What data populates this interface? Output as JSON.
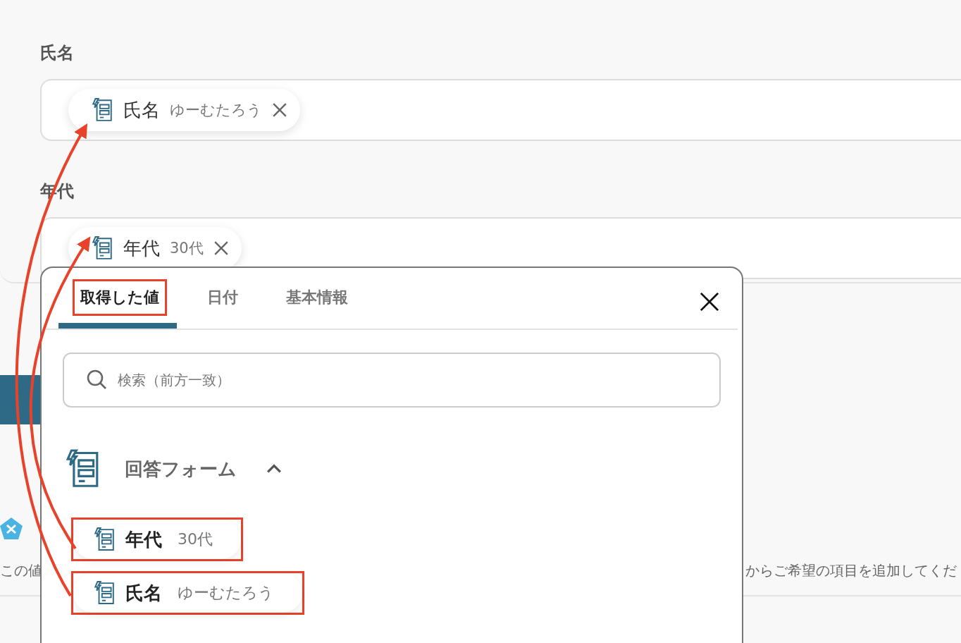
{
  "fields": [
    {
      "label": "氏名",
      "chip": {
        "name": "氏名",
        "value": "ゆーむたろう"
      }
    },
    {
      "label": "年代",
      "chip": {
        "name": "年代",
        "value": "30代"
      }
    }
  ],
  "behind": {
    "description_left": "この値",
    "description_right": "からご希望の項目を追加してくだ"
  },
  "popup": {
    "tabs": [
      {
        "label": "取得した値",
        "selected": true,
        "highlighted": true
      },
      {
        "label": "日付",
        "selected": false,
        "highlighted": false
      },
      {
        "label": "基本情報",
        "selected": false,
        "highlighted": false
      }
    ],
    "search": {
      "placeholder": "検索（前方一致）"
    },
    "group": {
      "title": "回答フォーム",
      "expanded": true,
      "items": [
        {
          "name": "年代",
          "value": "30代",
          "highlighted": true
        },
        {
          "name": "氏名",
          "value": "ゆーむたろう",
          "highlighted": true
        }
      ]
    }
  }
}
